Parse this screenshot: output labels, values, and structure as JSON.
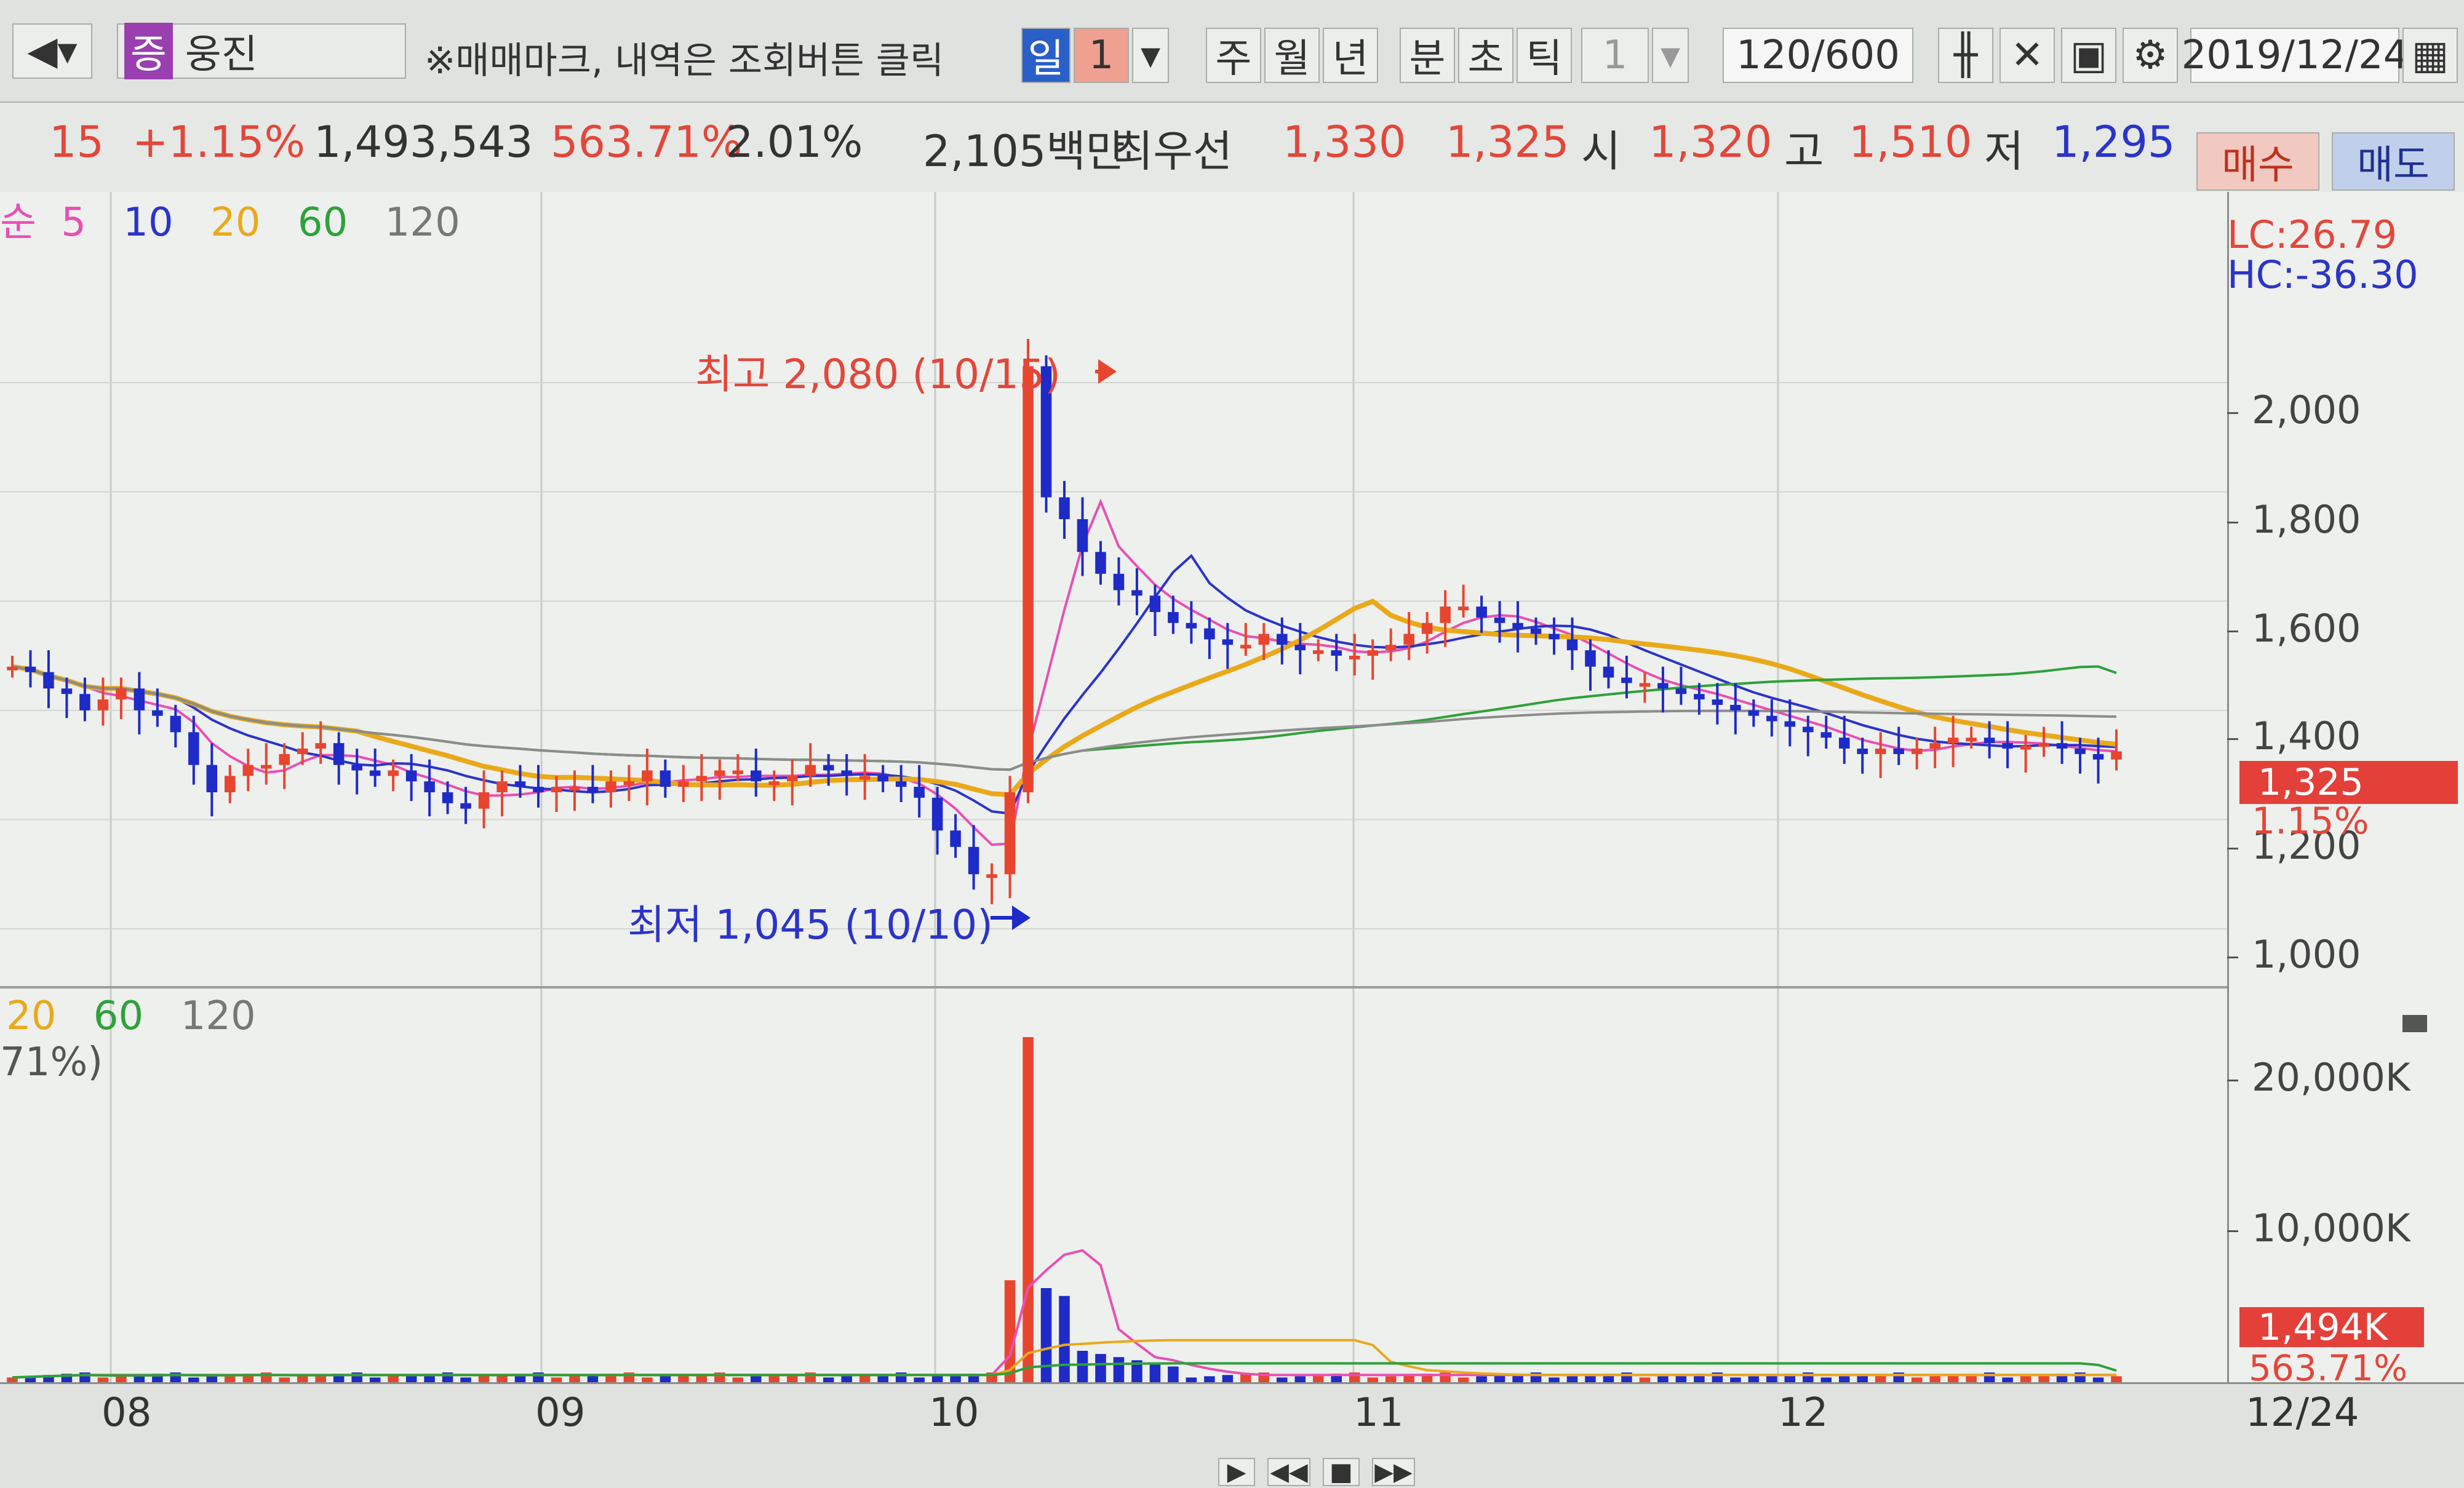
{
  "toolbar": {
    "stock_badge": "증",
    "stock_name": "웅진",
    "hint": "※매매마크, 내역은 조회버튼 클릭",
    "period_tabs": [
      "일",
      "1",
      "주",
      "월",
      "년",
      "분",
      "초",
      "틱",
      "1"
    ],
    "count": "120",
    "count_total": "/600",
    "date": "2019/12/24"
  },
  "info": {
    "change": "15",
    "change_pct": "+1.15%",
    "volume": "1,493,543",
    "volume_ratio": "563.71%",
    "turnover": "2.01%",
    "amount": "2,105백만",
    "best_label": "최우선",
    "best_ask": "1,330",
    "best_bid": "1,325",
    "open_label": "시",
    "open": "1,320",
    "high_label": "고",
    "high": "1,510",
    "low_label": "저",
    "low": "1,295",
    "buy": "매수",
    "sell": "매도"
  },
  "price_legend": [
    "순",
    "5",
    "10",
    "20",
    "60",
    "120"
  ],
  "volume_legend": [
    "20",
    "60",
    "120"
  ],
  "volume_legend_extra": "71%)",
  "lc": "LC:26.79",
  "hc": "HC:-36.30",
  "annotations": {
    "high": "최고 2,080 (10/15)",
    "low": "최저 1,045 (10/10)"
  },
  "current_price": "1,325",
  "current_pct": "1.15%",
  "current_volume": "1,494K",
  "current_volume_pct": "563.71%",
  "x_labels": [
    "08",
    "09",
    "10",
    "11",
    "12",
    "12/24"
  ],
  "colors": {
    "up": "#e8452f",
    "down": "#1e2bc8",
    "ma5": "#e94fb3",
    "ma10": "#2b34c8",
    "ma20": "#e9a91a",
    "ma60": "#2ea13a",
    "ma120": "#8c8c8c"
  },
  "chart_data": {
    "type": "candlestick",
    "ylim": [
      950,
      2180
    ],
    "yticks": [
      "2,000",
      "1,800",
      "1,600",
      "1,400",
      "1,200",
      "1,000"
    ],
    "volume_ticks": [
      "20,000K",
      "10,000K"
    ],
    "highlight": {
      "high": 2080,
      "low": 1045
    },
    "closes": [
      1480,
      1470,
      1440,
      1430,
      1400,
      1420,
      1440,
      1400,
      1390,
      1360,
      1300,
      1250,
      1280,
      1300,
      1300,
      1320,
      1330,
      1340,
      1300,
      1290,
      1280,
      1290,
      1270,
      1250,
      1230,
      1220,
      1250,
      1270,
      1260,
      1250,
      1260,
      1260,
      1250,
      1270,
      1270,
      1290,
      1260,
      1270,
      1280,
      1290,
      1290,
      1270,
      1270,
      1280,
      1300,
      1290,
      1280,
      1280,
      1270,
      1260,
      1240,
      1180,
      1150,
      1100,
      1100,
      1250,
      2030,
      1790,
      1750,
      1690,
      1650,
      1620,
      1610,
      1580,
      1560,
      1550,
      1530,
      1520,
      1520,
      1540,
      1520,
      1510,
      1510,
      1500,
      1500,
      1510,
      1520,
      1540,
      1560,
      1590,
      1590,
      1570,
      1560,
      1550,
      1540,
      1530,
      1510,
      1480,
      1460,
      1450,
      1450,
      1440,
      1430,
      1420,
      1410,
      1400,
      1390,
      1380,
      1370,
      1360,
      1350,
      1330,
      1320,
      1330,
      1320,
      1330,
      1340,
      1350,
      1350,
      1340,
      1330,
      1335,
      1340,
      1330,
      1320,
      1310,
      1325
    ]
  }
}
